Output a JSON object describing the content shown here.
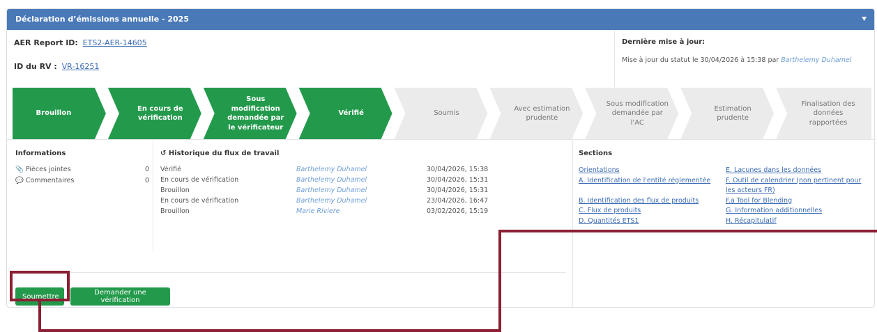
{
  "header": {
    "title": "Déclaration d’émissions annuelle - 2025",
    "collapse_icon": "double-chevron-down-icon"
  },
  "report": {
    "aer_label": "AER Report ID:",
    "aer_id": "ETS2-AER-14605",
    "rv_label": "ID du RV :",
    "rv_id": "VR-16251"
  },
  "last_update": {
    "title": "Dernière mise à jour:",
    "text": "Mise à jour du statut le 30/04/2026 à 15:38 par",
    "user": "Barthelemy Duhamel"
  },
  "steps": [
    {
      "label": "Brouillon",
      "state": "done"
    },
    {
      "label": "En cours de vérification",
      "state": "done"
    },
    {
      "label": "Sous modification demandée par le vérificateur",
      "state": "done"
    },
    {
      "label": "Vérifié",
      "state": "done"
    },
    {
      "label": "Soumis",
      "state": "todo"
    },
    {
      "label": "Avec estimation prudente",
      "state": "todo"
    },
    {
      "label": "Sous modification demandée par l'AC",
      "state": "todo"
    },
    {
      "label": "Estimation prudente",
      "state": "todo"
    },
    {
      "label": "Finalisation des données rapportées",
      "state": "todo"
    }
  ],
  "informations": {
    "title": "Informations",
    "items": [
      {
        "label": "Pièces jointes",
        "count": "0",
        "icon": "paperclip-icon"
      },
      {
        "label": "Commentaires",
        "count": "0",
        "icon": "comments-icon"
      }
    ]
  },
  "history": {
    "title": "Historique du flux de travail",
    "icon": "history-icon",
    "rows": [
      {
        "status": "Vérifié",
        "user": "Barthelemy Duhamel",
        "date": "30/04/2026, 15:38"
      },
      {
        "status": "En cours de vérification",
        "user": "Barthelemy Duhamel",
        "date": "30/04/2026, 15:31"
      },
      {
        "status": "Brouillon",
        "user": "Barthelemy Duhamel",
        "date": "30/04/2026, 15:31"
      },
      {
        "status": "En cours de vérification",
        "user": "Barthelemy Duhamel",
        "date": "23/04/2026, 16:47"
      },
      {
        "status": "Brouillon",
        "user": "Marie Riviere",
        "date": "03/02/2026, 15:19"
      }
    ]
  },
  "sections": {
    "title": "Sections",
    "col1": [
      "Orientations",
      "A. Identification de l'entité réglementée",
      "",
      "B. Identification des flux de produits",
      "C. Flux de produits",
      "D. Quantités ETS1"
    ],
    "col2": [
      "E. Lacunes dans les données",
      "F. Outil de calendrier (non pertinent pour",
      "les acteurs FR)",
      "F.a Tool for Blending",
      "G. Information additionnelles",
      "H. Récapitulatif"
    ]
  },
  "actions": {
    "submit_label": "Soumettre",
    "request_label": "Demander une vérification"
  },
  "colors": {
    "header": "#4a79b8",
    "done": "#239a4b",
    "todo": "#ebebeb",
    "highlight": "#8b1f33",
    "link": "#3b6bb5"
  }
}
